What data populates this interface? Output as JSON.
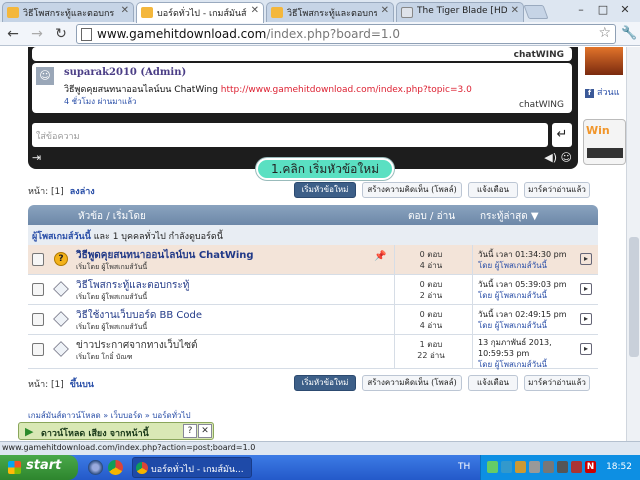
{
  "tabs": [
    {
      "label": "วิธีโพสกระทู้และตอบกร",
      "active": false
    },
    {
      "label": "บอร์ดทั่วไป - เกมส์มันส์",
      "active": true
    },
    {
      "label": "วิธีโพสกระทู้และตอบกร",
      "active": false
    },
    {
      "label": "The Tiger Blade [HD]",
      "active": false
    }
  ],
  "window": {
    "minimize": "–",
    "maximize": "□",
    "close": "✕"
  },
  "toolbar": {
    "back": "←",
    "forward": "→",
    "reload": "↻",
    "url_host": "www.gamehitdownload.com",
    "url_path": "/index.php?board=1.0",
    "star": "☆",
    "wrench": "🔧"
  },
  "chat": {
    "msg1_footer": "chatWING",
    "msg2_name": "suparak2010 (Admin)",
    "msg2_text": "วิธีพูดคุยสนทนาออนไลน์บน ChatWing ",
    "msg2_link": "http://www.gamehitdownload.com/index.php?topic=3.0",
    "msg2_time": "4 ชั่วโมง ผ่านมาแล้ว",
    "msg2_footer_a": "chat",
    "msg2_footer_b": "WING",
    "input_placeholder": "ใส่ข้อความ",
    "send_icon": "↵",
    "exit_icon": "⇥",
    "extra_icons": "◀) ☺"
  },
  "callout": "1.คลิก เริ่มหัวข้อใหม่",
  "sidebar": {
    "link": "ส่วนแ",
    "fb": "f",
    "widget": "Win"
  },
  "pager_top": {
    "label": "หน้า: [1]",
    "jump": "ลงล่าง"
  },
  "pager_bottom": {
    "label": "หน้า: [1]",
    "jump": "ขึ้นบน"
  },
  "buttons": {
    "new_topic": "เริ่มหัวข้อใหม่",
    "poll": "สร้างความคิดเห็น (โพลล์)",
    "notify": "แจ้งเตือน",
    "mark_read": "มาร์คว่าอ่านแล้ว"
  },
  "table": {
    "col_subject": "หัวข้อ / เริ่มโดย",
    "col_replies": "ตอบ / อ่าน",
    "col_last": "กระทู้ล่าสุด ▼",
    "info_user": "ผู้โพสเกมส์วันนี้",
    "info_rest": " และ 1 บุคคลทั่วไป กำลังดูบอร์ดนี้",
    "rows": [
      {
        "title": "วิธีพูดคุยสนทนาออนไลน์บน ChatWing",
        "author": "เริ่มโดย ผู้โพสเกมส์วันนี้",
        "replies": "0 ตอบ",
        "views": "4 อ่าน",
        "last_date": "วันนี้ เวลา 01:34:30 pm",
        "last_by": "โดย ผู้โพสเกมส์วันนี้",
        "sticky": true,
        "pin": "📌",
        "mark": "?"
      },
      {
        "title": "วิธีโพสกระทู้และตอบกระทู้",
        "author": "เริ่มโดย ผู้โพสเกมส์วันนี้",
        "replies": "0 ตอบ",
        "views": "2 อ่าน",
        "last_date": "วันนี้ เวลา 05:39:03 pm",
        "last_by": "โดย ผู้โพสเกมส์วันนี้",
        "sticky": false,
        "pin": "",
        "mark": ""
      },
      {
        "title": "วิธีใช้งานเว็บบอร์ด BB Code",
        "author": "เริ่มโดย ผู้โพสเกมส์วันนี้",
        "replies": "0 ตอบ",
        "views": "4 อ่าน",
        "last_date": "วันนี้ เวลา 02:49:15 pm",
        "last_by": "โดย ผู้โพสเกมส์วันนี้",
        "sticky": false,
        "pin": "",
        "mark": ""
      },
      {
        "title": "ข่าวประกาศจากทางเว็บไซต์",
        "author": "เริ่มโดย โกอิ๋ บัณฑ",
        "replies": "1 ตอบ",
        "views": "22 อ่าน",
        "last_date": "13 กุมภาพันธ์ 2013,",
        "last_date2": "10:59:53 pm",
        "last_by": "โดย ผู้โพสเกมส์วันนี้",
        "sticky": false,
        "pin": "",
        "mark": ""
      }
    ],
    "go_icon": "▸"
  },
  "breadcrumb": "เกมส์มันส์ดาวน์โหลด » เว็บบอร์ด » บอร์ดทั่วไป",
  "download_bar": {
    "play": "▶",
    "label": "ดาวน์โหลด เสียง จากหน้านี้",
    "help": "?",
    "close": "✕"
  },
  "status_text": "www.gamehitdownload.com/index.php?action=post;board=1.0",
  "taskbar": {
    "start": "start",
    "item": "บอร์ดทั่วไป - เกมส์มัน...",
    "lang": "TH",
    "clock": "18:52"
  }
}
